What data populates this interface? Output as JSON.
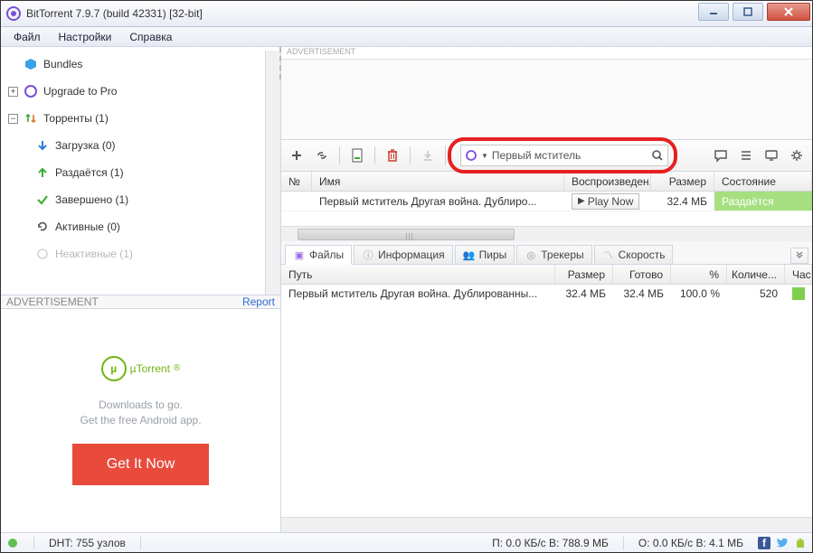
{
  "window": {
    "title": "BitTorrent 7.9.7  (build 42331) [32-bit]"
  },
  "menu": {
    "file": "Файл",
    "settings": "Настройки",
    "help": "Справка"
  },
  "sidebar": {
    "bundles": "Bundles",
    "upgrade": "Upgrade to Pro",
    "torrents": "Торренты (1)",
    "download": "Загрузка (0)",
    "seeding": "Раздаётся (1)",
    "completed": "Завершено (1)",
    "active": "Активные (0)",
    "inactive": "Неактивные (1)"
  },
  "ad": {
    "label": "ADVERTISEMENT",
    "report": "Report",
    "brand": "µTorrent",
    "suffix": "®",
    "line1": "Downloads to go.",
    "line2": "Get the free Android app.",
    "button": "Get It Now"
  },
  "adv_top": "ADVERTISEMENT",
  "search": {
    "value": "Первый мститель"
  },
  "grid": {
    "headers": {
      "num": "№",
      "name": "Имя",
      "play": "Воспроизведен...",
      "size": "Размер",
      "state": "Состояние"
    },
    "row": {
      "name": "Первый мститель Другая война. Дублиро...",
      "play": "Play Now",
      "size": "32.4 МБ",
      "state": "Раздаётся"
    }
  },
  "tabs": {
    "files": "Файлы",
    "info": "Информация",
    "peers": "Пиры",
    "trackers": "Трекеры",
    "speed": "Скорость"
  },
  "detail": {
    "headers": {
      "path": "Путь",
      "size": "Размер",
      "done": "Готово",
      "pct": "%",
      "pieces": "Количе...",
      "bar": "Час"
    },
    "row": {
      "path": "Первый мститель Другая война. Дублированны...",
      "size": "32.4 МБ",
      "done": "32.4 МБ",
      "pct": "100.0 %",
      "pieces": "520"
    }
  },
  "status": {
    "dht": "DHT: 755 узлов",
    "net": "П: 0.0 КБ/с В: 788.9 МБ",
    "net2": "О: 0.0 КБ/с В: 4.1 МБ"
  }
}
